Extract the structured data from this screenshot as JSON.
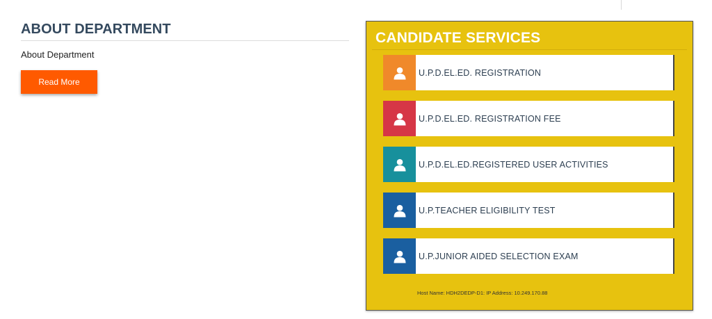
{
  "about": {
    "title": "ABOUT DEPARTMENT",
    "text": "About Department",
    "button_label": "Read More"
  },
  "candidate_services": {
    "title": "CANDIDATE SERVICES",
    "items": [
      {
        "label": "U.P.D.EL.ED. REGISTRATION",
        "icon": "user-icon",
        "color": "#f0892a"
      },
      {
        "label": "U.P.D.EL.ED. REGISTRATION FEE",
        "icon": "user-icon",
        "color": "#d63646"
      },
      {
        "label": "U.P.D.EL.ED.REGISTERED USER ACTIVITIES",
        "icon": "user-icon",
        "color": "#17909c"
      },
      {
        "label": "U.P.TEACHER ELIGIBILITY TEST",
        "icon": "user-icon",
        "color": "#1a5fa0"
      },
      {
        "label": "U.P.JUNIOR AIDED SELECTION EXAM",
        "icon": "user-icon",
        "color": "#1a5fa0"
      }
    ],
    "host_info": "Host Name: HDH2DEDP-D1: IP Address: 10.249.170.88"
  },
  "colors": {
    "accent_button": "#ff5a00",
    "panel_background": "#e7c20f",
    "heading": "#34495e"
  }
}
